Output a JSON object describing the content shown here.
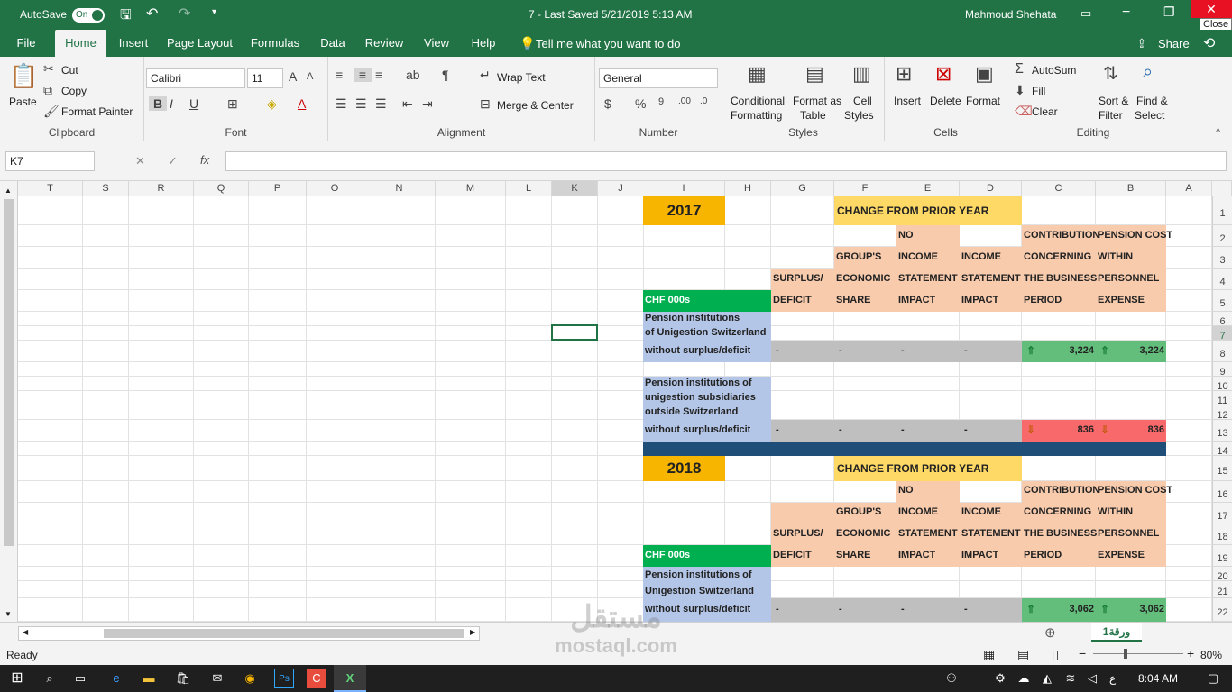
{
  "titlebar": {
    "autosave": "AutoSave",
    "toggle": "On",
    "doc_title": "7  -  Last Saved 5/21/2019 5:13 AM",
    "user": "Mahmoud Shehata",
    "close_tip": "Close"
  },
  "tabs": [
    "File",
    "Home",
    "Insert",
    "Page Layout",
    "Formulas",
    "Data",
    "Review",
    "View",
    "Help"
  ],
  "tell_me": "Tell me what you want to do",
  "share": "Share",
  "ribbon": {
    "clipboard": {
      "paste": "Paste",
      "cut": "Cut",
      "copy": "Copy",
      "format_painter": "Format Painter",
      "label": "Clipboard"
    },
    "font": {
      "name": "Calibri",
      "size": "11",
      "label": "Font"
    },
    "alignment": {
      "wrap": "Wrap Text",
      "merge": "Merge & Center",
      "label": "Alignment"
    },
    "number": {
      "format": "General",
      "label": "Number"
    },
    "styles": {
      "conditional": "Conditional",
      "conditional2": "Formatting",
      "format_table": "Format as",
      "format_table2": "Table",
      "cell_styles": "Cell",
      "cell_styles2": "Styles",
      "label": "Styles"
    },
    "cells": {
      "insert": "Insert",
      "delete": "Delete",
      "format": "Format",
      "label": "Cells"
    },
    "editing": {
      "autosum": "AutoSum",
      "fill": "Fill",
      "clear": "Clear",
      "sort": "Sort &",
      "sort2": "Filter",
      "find": "Find &",
      "find2": "Select",
      "label": "Editing"
    }
  },
  "formula": {
    "namebox": "K7",
    "value": ""
  },
  "columns": [
    [
      "T",
      20,
      72
    ],
    [
      "S",
      92,
      51
    ],
    [
      "R",
      143,
      72
    ],
    [
      "Q",
      215,
      61
    ],
    [
      "P",
      276,
      64
    ],
    [
      "O",
      340,
      63
    ],
    [
      "N",
      403,
      80
    ],
    [
      "M",
      483,
      78
    ],
    [
      "L",
      561,
      51
    ],
    [
      "K",
      612,
      51
    ],
    [
      "J",
      663,
      51
    ],
    [
      "I",
      713,
      91
    ],
    [
      "H",
      804,
      51
    ],
    [
      "G",
      855,
      70
    ],
    [
      "F",
      925,
      69
    ],
    [
      "E",
      994,
      70
    ],
    [
      "D",
      1064,
      69
    ],
    [
      "C",
      1133,
      82
    ],
    [
      "B",
      1215,
      78
    ],
    [
      "A",
      1293,
      51
    ]
  ],
  "rows": [
    "1",
    "2",
    "3",
    "4",
    "5",
    "6",
    "7",
    "8",
    "9",
    "10",
    "11",
    "12",
    "13",
    "14",
    "15",
    "16",
    "17",
    "18",
    "19",
    "20",
    "21",
    "22"
  ],
  "table1": {
    "year": "2017",
    "change": "CHANGE FROM PRIOR YEAR",
    "unit": "CHF 000s",
    "h_no": "NO",
    "h_contribution": "CONTRIBUTION",
    "h_pension": "PENSION COST",
    "h_groups": "GROUP'S",
    "h_income": "INCOME",
    "h_income2": "INCOME",
    "h_concerning": "CONCERNING",
    "h_within": "WITHIN",
    "h_surplus": "SURPLUS/",
    "h_economic": "ECONOMIC",
    "h_statement": "STATEMENT",
    "h_statement2": "STATEMENT",
    "h_business": "THE BUSINESS",
    "h_personnel": "PERSONNEL",
    "h_deficit": "DEFICIT",
    "h_share": "SHARE",
    "h_impact": "IMPACT",
    "h_impact2": "IMPACT",
    "h_period": "PERIOD",
    "h_expense": "EXPENSE",
    "r1a": "Pension institutions",
    "r1b": "of Unigestion Switzerland",
    "r1c": "without surplus/deficit",
    "r2a": "Pension institutions of",
    "r2b": "unigestion subsidiaries",
    "r2c": "outside Switzerland",
    "r2d": "without surplus/deficit",
    "dash": "-",
    "v1c": "3,224",
    "v1b": "3,224",
    "v2c": "836",
    "v2b": "836"
  },
  "table2": {
    "year": "2018",
    "change": "CHANGE FROM PRIOR YEAR",
    "unit": "CHF 000s",
    "r1a": "Pension institutions of",
    "r1b": "Unigestion Switzerland",
    "r1c": "without surplus/deficit",
    "v1c": "3,062",
    "v1b": "3,062"
  },
  "sheet_tab": "ورقة1",
  "status": {
    "ready": "Ready",
    "zoom": "80%"
  },
  "watermark": {
    "ar": "مستقل",
    "en": "mostaql.com"
  },
  "taskbar": {
    "time": "8:04 AM",
    "lang": "ع"
  },
  "colors": {
    "excel_green": "#217346",
    "year_gold": "#f7b500",
    "change_yellow": "#ffd966",
    "peach": "#f8cbad",
    "blue_label": "#b4c6e7",
    "green_unit": "#00b050",
    "gray_row": "#bfbfbf",
    "up_green": "#63be7b",
    "down_red": "#f8696b",
    "divider": "#1f4e79"
  }
}
